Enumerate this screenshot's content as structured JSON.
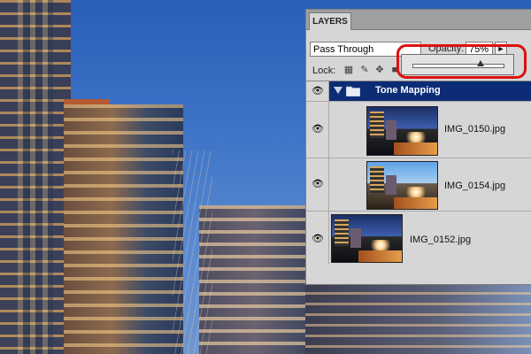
{
  "panel": {
    "tab_label": "LAYERS",
    "blend_mode": "Pass Through",
    "opacity_label": "Opacity:",
    "opacity_value": "75%",
    "opacity_fraction": 0.75,
    "lock_label": "Lock:",
    "lock_icons": [
      "lock-transparent-pixels-icon",
      "lock-image-pixels-icon",
      "lock-position-icon",
      "lock-all-icon"
    ]
  },
  "layers": [
    {
      "name": "Tone Mapping",
      "type": "group",
      "selected": true,
      "visible": true
    },
    {
      "name": "IMG_0150.jpg",
      "type": "layer",
      "visible": true,
      "indented": true
    },
    {
      "name": "IMG_0154.jpg",
      "type": "layer",
      "visible": true,
      "indented": true
    },
    {
      "name": "IMG_0152.jpg",
      "type": "layer",
      "visible": true,
      "indented": false
    }
  ],
  "colors": {
    "selection": "#0c2d75",
    "highlight": "#e01010",
    "panel_bg": "#d6d6d6"
  }
}
